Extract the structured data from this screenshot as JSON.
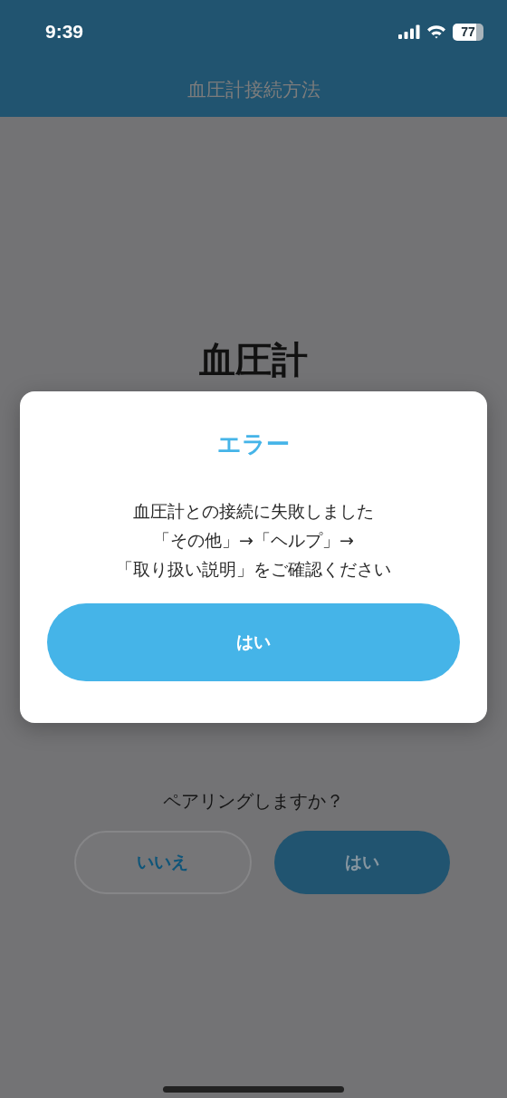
{
  "status_bar": {
    "time": "9:39",
    "battery": "77"
  },
  "header": {
    "title": "血圧計接続方法"
  },
  "content": {
    "title": "血圧計",
    "question": "ペアリングしますか？",
    "buttons": [
      {
        "label": "いいえ",
        "kind": "outline"
      },
      {
        "label": "はい",
        "kind": "filled"
      }
    ]
  },
  "dialog": {
    "title": "エラー",
    "message_lines": [
      "血圧計との接続に失敗しました",
      "「その他」→「ヘルプ」→",
      "「取り扱い説明」をご確認ください"
    ],
    "button": "はい"
  }
}
